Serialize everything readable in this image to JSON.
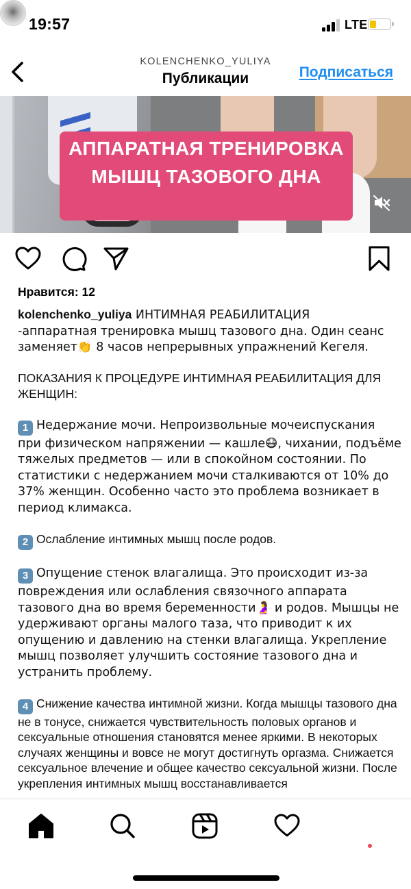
{
  "status_bar": {
    "time": "19:57",
    "network": "LTE",
    "battery_level": 0.25,
    "battery_color": "#f5c400"
  },
  "header": {
    "username": "KOLENCHENKO_YULIYA",
    "title": "Публикации",
    "follow_label": "Подписаться",
    "follow_color": "#1f8ef0",
    "back_icon": "chevron-left-icon"
  },
  "media": {
    "overlay_line1": "АППАРАТНАЯ ТРЕНИРОВКА",
    "overlay_line2": "МЫШЦ ТАЗОВОГО ДНА",
    "banner_color": "#e24b78",
    "sound_icon": "speaker-muted-icon"
  },
  "actions": {
    "icons": [
      "heart-icon",
      "comment-icon",
      "paper-plane-icon",
      "bookmark-icon"
    ]
  },
  "likes_text": "Нравится: 12",
  "caption": {
    "username": "kolenchenko_yuliya",
    "intro": " ИНТИМНАЯ РЕАБИЛИТАЦИЯ\n-аппаратная тренировка мышц тазового дна. Один сеанс заменяет👏 8 часов непрерывных упражнений Кегеля.",
    "heading": "ПОКАЗАНИЯ К ПРОЦЕДУРЕ ИНТИМНАЯ РЕАБИЛИТАЦИЯ ДЛЯ ЖЕНЩИН:",
    "items": [
      {
        "num": "1",
        "text": "Недержание мочи. Непроизвольные мочеиспускания при физическом напряжении — кашле😷, чихании, подъёме тяжелых предметов — или в спокойном состоянии. По статистики с недержанием мочи сталкиваются от 10% до 37% женщин. Особенно часто это проблема возникает в период климакса."
      },
      {
        "num": "2",
        "text": "Ослабление интимных мышц после родов."
      },
      {
        "num": "3",
        "text": "Опущение стенок влагалища. Это происходит из-за повреждения или ослабления связочного аппарата тазового дна во время беременности🤰 и родов. Мышцы не удерживают органы малого таза, что приводит к их опущению и давлению на стенки влагалища. Укрепление мышц позволяет улучшить состояние тазового дна и устранить проблему."
      },
      {
        "num": "4",
        "text": "Снижение качества интимной жизни. Когда мышцы тазового дна не в тонусе, снижается чувствительность половых органов и сексуальные отношения становятся менее яркими. В некоторых случаях женщины и вовсе не могут достигнуть оргазма. Снижается сексуальное влечение и общее качество сексуальной жизни. После укрепления интимных мышц восстанавливается"
      }
    ]
  },
  "tab_bar": {
    "tabs": [
      "home-icon",
      "search-icon",
      "reels-icon",
      "heart-icon",
      "profile-avatar"
    ],
    "notification_dot_color": "#ed4956"
  }
}
